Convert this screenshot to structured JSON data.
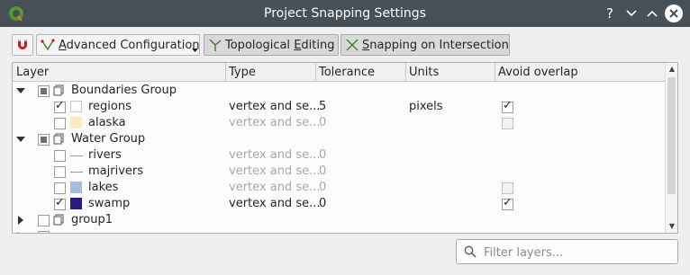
{
  "window": {
    "title": "Project Snapping Settings",
    "controls": [
      "help",
      "minimize",
      "maximize",
      "close"
    ],
    "help_label": "?"
  },
  "toolbar": {
    "snapping_toggle_icon": "magnet-icon",
    "mode_button": {
      "label_pre": "",
      "label_mnemonic": "A",
      "label_post": "dvanced Configuration"
    },
    "topological_button": {
      "label_pre": "Topological ",
      "label_mnemonic": "E",
      "label_post": "diting",
      "checked": true
    },
    "intersection_button": {
      "label_pre": "",
      "label_mnemonic": "S",
      "label_post": "napping on Intersection",
      "checked": true
    }
  },
  "tree": {
    "columns": [
      "Layer",
      "Type",
      "Tolerance",
      "Units",
      "Avoid overlap"
    ],
    "rows": [
      {
        "kind": "group",
        "name": "Boundaries Group",
        "expanded": true,
        "check": "partial"
      },
      {
        "kind": "layer",
        "name": "regions",
        "checked": true,
        "symbol": "fill",
        "symbol_color": "#ffffff",
        "type": "vertex and se...",
        "tolerance": "5",
        "units": "pixels",
        "avoid_overlap": "checked"
      },
      {
        "kind": "layer",
        "name": "alaska",
        "checked": false,
        "symbol": "fill",
        "symbol_color": "#fbebc3",
        "type": "vertex and se...",
        "tolerance": "0",
        "units": "",
        "avoid_overlap": "disabled"
      },
      {
        "kind": "group",
        "name": "Water Group",
        "expanded": true,
        "check": "partial"
      },
      {
        "kind": "layer",
        "name": "rivers",
        "checked": false,
        "symbol": "line",
        "symbol_color": "#7a9cc6",
        "type": "vertex and se...",
        "tolerance": "0",
        "units": "",
        "avoid_overlap": "none"
      },
      {
        "kind": "layer",
        "name": "majrivers",
        "checked": false,
        "symbol": "line",
        "symbol_color": "#7a9cc6",
        "type": "vertex and se...",
        "tolerance": "0",
        "units": "",
        "avoid_overlap": "none"
      },
      {
        "kind": "layer",
        "name": "lakes",
        "checked": false,
        "symbol": "fill",
        "symbol_color": "#a6bedc",
        "type": "vertex and se...",
        "tolerance": "0",
        "units": "",
        "avoid_overlap": "disabled"
      },
      {
        "kind": "layer",
        "name": "swamp",
        "checked": true,
        "symbol": "fill",
        "symbol_color": "#2a1b80",
        "type": "vertex and se...",
        "tolerance": "0",
        "units": "",
        "avoid_overlap": "checked"
      },
      {
        "kind": "group",
        "name": "group1",
        "expanded": false,
        "check": "off"
      }
    ]
  },
  "search": {
    "placeholder": "Filter layers...",
    "value": ""
  }
}
